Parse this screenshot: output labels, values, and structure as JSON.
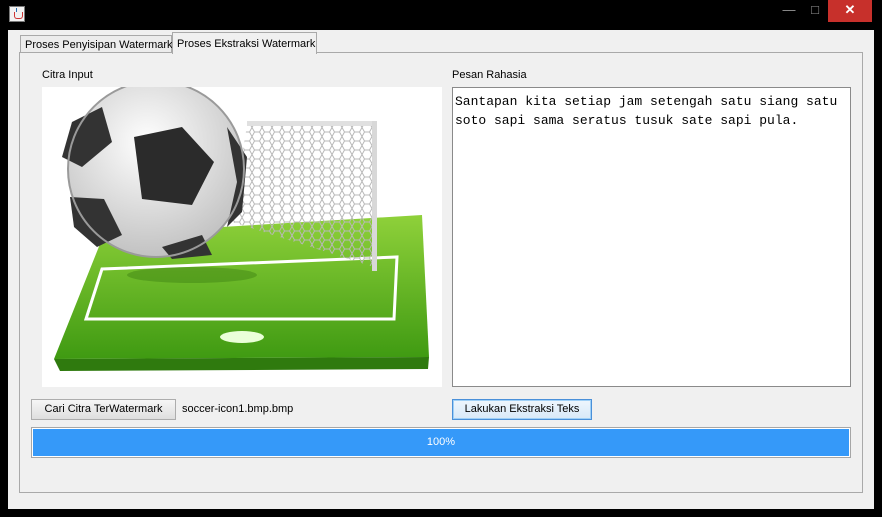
{
  "window": {
    "minimize_glyph": "—",
    "maximize_glyph": "□",
    "close_glyph": "✕"
  },
  "tabs": [
    {
      "label": "Proses Penyisipan Watermark",
      "active": false
    },
    {
      "label": "Proses Ekstraksi Watermark",
      "active": true
    }
  ],
  "citra_input": {
    "label": "Citra Input",
    "image_icon": "soccer-ball-goal-field-image"
  },
  "pesan_rahasia": {
    "label": "Pesan Rahasia",
    "text": "Santapan kita setiap jam setengah satu siang satu\nsoto sapi sama seratus tusuk sate sapi pula."
  },
  "controls": {
    "browse_button": "Cari Citra TerWatermark",
    "file_name": "soccer-icon1.bmp.bmp",
    "extract_button": "Lakukan Ekstraksi Teks"
  },
  "progress": {
    "value": 1.0,
    "text": "100%"
  },
  "colors": {
    "progress_fill": "#3599f9",
    "close_button": "#c7302b"
  }
}
